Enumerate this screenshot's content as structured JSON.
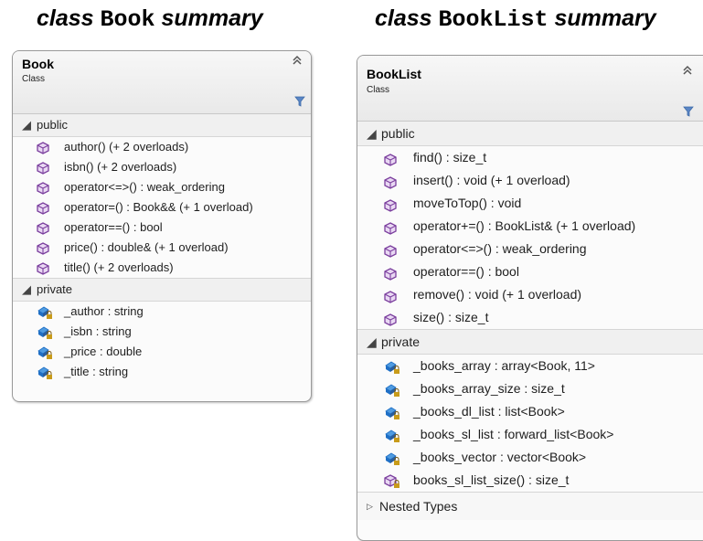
{
  "headings": {
    "left": {
      "keyword": "class",
      "name": "Book",
      "suffix": "summary"
    },
    "right": {
      "keyword": "class",
      "name": "BookList",
      "suffix": "summary"
    }
  },
  "book": {
    "title": "Book",
    "kind": "Class",
    "public_label": "public",
    "private_label": "private",
    "public_members": [
      "author() (+ 2 overloads)",
      "isbn() (+ 2 overloads)",
      "operator<=>() : weak_ordering",
      "operator=() : Book&& (+ 1 overload)",
      "operator==() : bool",
      "price() : double& (+ 1 overload)",
      "title() (+ 2 overloads)"
    ],
    "private_members": [
      "_author : string",
      "_isbn : string",
      "_price : double",
      "_title : string"
    ]
  },
  "booklist": {
    "title": "BookList",
    "kind": "Class",
    "public_label": "public",
    "private_label": "private",
    "nested_label": "Nested Types",
    "public_members": [
      "find() : size_t",
      "insert() : void (+ 1 overload)",
      "moveToTop() : void",
      "operator+=() : BookList& (+ 1 overload)",
      "operator<=>() : weak_ordering",
      "operator==() : bool",
      "remove() : void (+ 1 overload)",
      "size() : size_t"
    ],
    "private_members": [
      "_books_array : array<Book, 11>",
      "_books_array_size : size_t",
      "_books_dl_list : list<Book>",
      "_books_sl_list : forward_list<Book>",
      "_books_vector : vector<Book>",
      "books_sl_list_size() : size_t"
    ]
  },
  "icons": {
    "method": "cube-method-icon",
    "field": "private-field-icon",
    "private_method": "private-method-icon",
    "collapse": "double-chevron-up-icon",
    "filter": "filter-icon"
  },
  "colors": {
    "method": "#7b3f9e",
    "field": "#1f6fc5",
    "lock": "#c89b1a"
  }
}
